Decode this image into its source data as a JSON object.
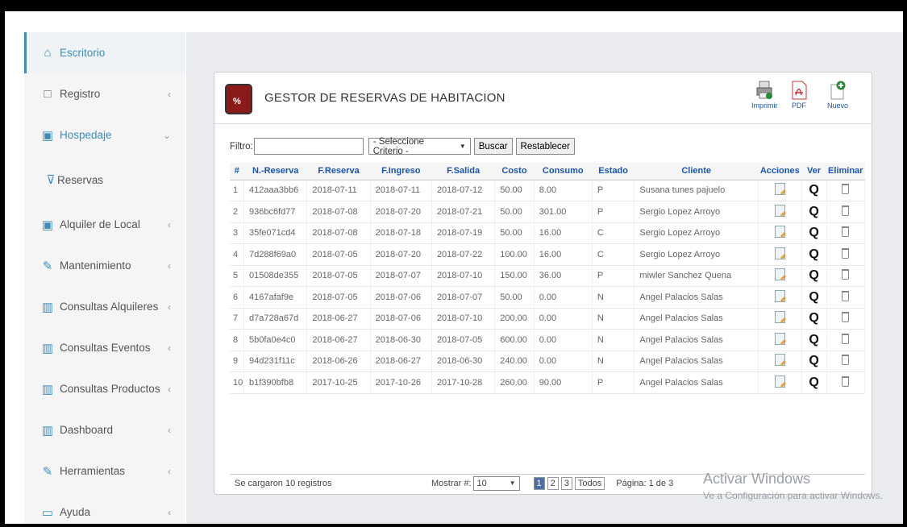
{
  "sidebar": {
    "items": [
      {
        "label": "Escritorio",
        "icon": "home-icon"
      },
      {
        "label": "Registro",
        "icon": "folder-icon"
      },
      {
        "label": "Hospedaje",
        "icon": "calendar-icon"
      },
      {
        "label": "Reservas",
        "icon": "cart-icon"
      },
      {
        "label": "Alquiler de Local",
        "icon": "calendar-icon"
      },
      {
        "label": "Mantenimiento",
        "icon": "wrench-icon"
      },
      {
        "label": "Consultas Alquileres",
        "icon": "bar-chart-icon"
      },
      {
        "label": "Consultas Eventos",
        "icon": "bar-chart-icon"
      },
      {
        "label": "Consultas Productos",
        "icon": "bar-chart-icon"
      },
      {
        "label": "Dashboard",
        "icon": "bar-chart-icon"
      },
      {
        "label": "Herramientas",
        "icon": "wrench-icon"
      },
      {
        "label": "Ayuda",
        "icon": "monitor-icon"
      }
    ]
  },
  "panel": {
    "title": "GESTOR DE RESERVAS DE HABITACION",
    "print_label": "Imprimir",
    "pdf_label": "PDF",
    "new_label": "Nuevo"
  },
  "filter": {
    "label": "Filtro:",
    "value": "",
    "criteria": "- Seleccione Criterio -",
    "search_label": "Buscar",
    "reset_label": "Restablecer"
  },
  "table": {
    "headers": [
      "#",
      "N.-Reserva",
      "F.Reserva",
      "F.Ingreso",
      "F.Salida",
      "Costo",
      "Consumo",
      "Estado",
      "Cliente",
      "Acciones",
      "Ver",
      "Eliminar"
    ],
    "rows": [
      [
        "1",
        "412aaa3bb6",
        "2018-07-11",
        "2018-07-11",
        "2018-07-12",
        "50.00",
        "8.00",
        "P",
        "Susana tunes pajuelo"
      ],
      [
        "2",
        "936bc6fd77",
        "2018-07-08",
        "2018-07-20",
        "2018-07-21",
        "50.00",
        "301.00",
        "P",
        "Sergio Lopez Arroyo"
      ],
      [
        "3",
        "35fe071cd4",
        "2018-07-08",
        "2018-07-18",
        "2018-07-19",
        "50.00",
        "16.00",
        "C",
        "Sergio Lopez Arroyo"
      ],
      [
        "4",
        "7d288f69a0",
        "2018-07-05",
        "2018-07-20",
        "2018-07-22",
        "100.00",
        "16.00",
        "C",
        "Sergio Lopez Arroyo"
      ],
      [
        "5",
        "01508de355",
        "2018-07-05",
        "2018-07-07",
        "2018-07-10",
        "150.00",
        "36.00",
        "P",
        "miwler Sanchez Quena"
      ],
      [
        "6",
        "4167afaf9e",
        "2018-07-05",
        "2018-07-06",
        "2018-07-07",
        "50.00",
        "0.00",
        "N",
        "Angel Palacios Salas"
      ],
      [
        "7",
        "d7a728a67d",
        "2018-06-27",
        "2018-07-06",
        "2018-07-10",
        "200.00",
        "0.00",
        "N",
        "Angel Palacios Salas"
      ],
      [
        "8",
        "5b0fa0e4c0",
        "2018-06-27",
        "2018-06-30",
        "2018-07-05",
        "600.00",
        "0.00",
        "N",
        "Angel Palacios Salas"
      ],
      [
        "9",
        "94d231f11c",
        "2018-06-26",
        "2018-06-27",
        "2018-06-30",
        "240.00",
        "0.00",
        "N",
        "Angel Palacios Salas"
      ],
      [
        "10",
        "b1f390bfb8",
        "2017-10-25",
        "2017-10-26",
        "2017-10-28",
        "260.00",
        "90.00",
        "P",
        "Angel Palacios Salas"
      ]
    ]
  },
  "footer": {
    "loaded": "Se cargaron 10 registros",
    "show_label": "Mostrar #:",
    "show_value": "10",
    "pages": [
      "1",
      "2",
      "3"
    ],
    "all_label": "Todos",
    "page_info": "Página: 1 de 3"
  },
  "watermark": {
    "line1": "Activar Windows",
    "line2": "Ve a Configuración para activar Windows."
  }
}
